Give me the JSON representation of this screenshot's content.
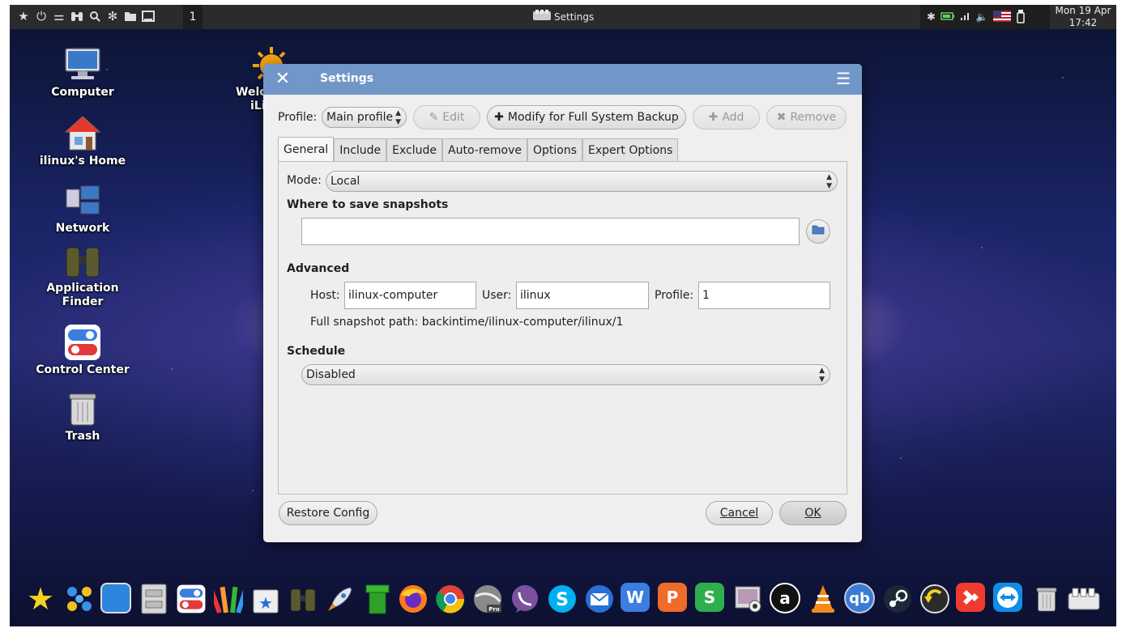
{
  "top_panel": {
    "workspace": "1",
    "task_title": "Settings",
    "clock_date": "Mon 19 Apr",
    "clock_time": "17:42",
    "left_icons": [
      "star-icon",
      "power-icon",
      "toggle-icon",
      "binoculars-icon",
      "search-icon",
      "settings-icon",
      "folder-icon",
      "window-icon"
    ],
    "tray_icons": [
      "bluetooth-icon",
      "battery-icon",
      "signal-icon",
      "volume-icon",
      "us-flag-icon",
      "usb-icon"
    ]
  },
  "desktop": {
    "icons": [
      {
        "label": "Computer"
      },
      {
        "label": "ilinux's Home"
      },
      {
        "label": "Network"
      },
      {
        "label": "Application Finder"
      },
      {
        "label": "Control Center"
      },
      {
        "label": "Trash"
      }
    ],
    "partial_icon": {
      "label_line1": "Welc",
      "label_line2": "iLi"
    }
  },
  "dialog": {
    "title": "Settings",
    "profile_label": "Profile:",
    "profile_value": "Main profile",
    "edit_label": "Edit",
    "modify_label": "Modify for Full System Backup",
    "add_label": "Add",
    "remove_label": "Remove",
    "tabs": [
      "General",
      "Include",
      "Exclude",
      "Auto-remove",
      "Options",
      "Expert Options"
    ],
    "mode_label": "Mode:",
    "mode_value": "Local",
    "where_heading": "Where to save snapshots",
    "where_value": "",
    "advanced_heading": "Advanced",
    "host_label": "Host:",
    "host_value": "ilinux-computer",
    "user_label": "User:",
    "user_value": "ilinux",
    "profile_field_label": "Profile:",
    "profile_field_value": "1",
    "full_path": "Full snapshot path: backintime/ilinux-computer/ilinux/1",
    "schedule_heading": "Schedule",
    "schedule_value": "Disabled",
    "restore_label": "Restore Config",
    "cancel_label": "Cancel",
    "ok_label": "OK"
  },
  "dock": {
    "items": [
      "star-icon",
      "apps-icon",
      "desktop-icon",
      "file-cabinet-icon",
      "control-center-icon",
      "palette-icon",
      "app-store-icon",
      "binoculars-icon",
      "rocket-icon",
      "pipe-icon",
      "firefox-icon",
      "chrome-icon",
      "earth-pro-icon",
      "viber-icon",
      "skype-icon",
      "mail-icon",
      "wps-writer-icon",
      "wps-presentation-icon",
      "wps-spreadsheet-icon",
      "webcam-icon",
      "amazon-icon",
      "vlc-icon",
      "qbittorrent-icon",
      "steam-icon",
      "backup-icon",
      "anydesk-icon",
      "teamviewer-icon",
      "trash-icon",
      "keyboard-icon"
    ],
    "labels": {
      "wps_writer": "W",
      "wps_presentation": "P",
      "wps_spreadsheet": "S",
      "qbittorrent": "qb",
      "amazon": "a"
    }
  }
}
